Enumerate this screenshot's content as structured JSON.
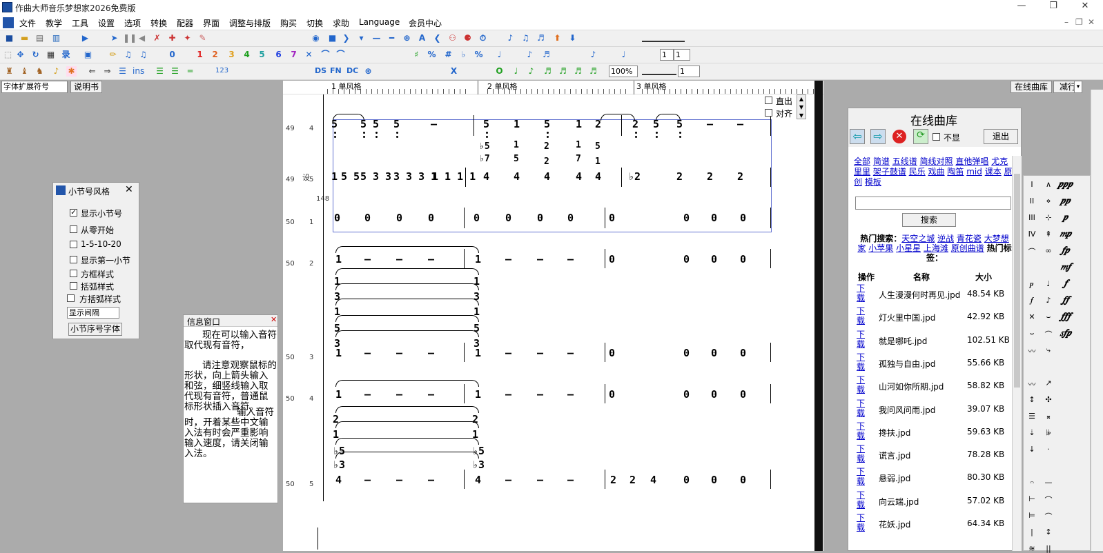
{
  "window": {
    "title": "作曲大师音乐梦想家2026免费版",
    "min": "—",
    "max": "❐",
    "close": "✕"
  },
  "menu": [
    "文件",
    "教学",
    "工具",
    "设置",
    "选项",
    "转换",
    "配器",
    "界面",
    "调整与排版",
    "购买",
    "切换",
    "求助",
    "Language",
    "会员中心"
  ],
  "toolbar": {
    "zoom": "100%",
    "field_a": "1",
    "field_b": "1",
    "field_c": "1"
  },
  "left_toolbar": {
    "symbol_select": "字体扩展符号",
    "manual_button": "说明书"
  },
  "bar_dialog": {
    "title": "小节号风格",
    "options": [
      {
        "label": "显示小节号",
        "checked": true
      },
      {
        "label": "从零开始",
        "checked": false
      },
      {
        "label": "1-5-10-20",
        "checked": false
      },
      {
        "label": "显示第一小节",
        "checked": false
      },
      {
        "label": "方框样式",
        "checked": false
      },
      {
        "label": "括弧样式",
        "checked": false
      },
      {
        "label": "方括弧样式",
        "checked": false
      }
    ],
    "interval_select": "显示间隔",
    "font_button": "小节序号字体"
  },
  "info_window": {
    "title": "信息窗口",
    "text1": "现在可以输入音符取代现有音符，",
    "text2": "请注意观察鼠标的形状，向上箭头输入和弦，细竖线输入取代现有音符，普通鼠标形状插入音符。",
    "text3": "输入音符时，开着某些中文输入法有时会严重影响输入速度，请关闭输入法。"
  },
  "score": {
    "rulers": [
      "1 单风格",
      "2 单风格",
      "3 单风格"
    ],
    "side_checks": [
      "直出",
      "对齐"
    ],
    "bar_label": "148",
    "track_label": "设",
    "row_meta": [
      [
        "49",
        "4"
      ],
      [
        "49",
        "5"
      ],
      [
        "50",
        "1"
      ],
      [
        "50",
        "2"
      ],
      [
        "50",
        "3"
      ],
      [
        "50",
        "4"
      ],
      [
        "50",
        "5"
      ]
    ]
  },
  "right_buttons": {
    "online": "在线曲库",
    "reduce": "减行"
  },
  "library": {
    "title": "在线曲库",
    "no_show": "不显",
    "exit": "退出",
    "links": [
      "全部",
      "简谱",
      "五线谱",
      "简线对照",
      "直他弹唱",
      "尤克里里",
      "架子鼓谱",
      "民乐",
      "戏曲",
      "陶笛",
      "mid",
      "课本",
      "原创",
      "模板"
    ],
    "search_button": "搜索",
    "hot_label": "热门搜索：",
    "hot_items": [
      "天空之城",
      "逆战",
      "青花瓷",
      "大梦想家",
      "小苹果",
      "小星星",
      "上海滩",
      "原创曲谱"
    ],
    "tag_label": "热门标签：",
    "headers": [
      "操作",
      "名称",
      "大小"
    ],
    "download": "下载",
    "files": [
      {
        "name": "人生漫漫何时再见.jpd",
        "size": "48.54 KB"
      },
      {
        "name": "灯火里中国.jpd",
        "size": "42.92 KB"
      },
      {
        "name": "就是哪吒.jpd",
        "size": "102.51 KB"
      },
      {
        "name": "孤独与自由.jpd",
        "size": "55.66 KB"
      },
      {
        "name": "山河如你所期.jpd",
        "size": "58.82 KB"
      },
      {
        "name": "我问风问雨.jpd",
        "size": "39.07 KB"
      },
      {
        "name": "搀扶.jpd",
        "size": "59.63 KB"
      },
      {
        "name": "谎言.jpd",
        "size": "78.28 KB"
      },
      {
        "name": "悬弱.jpd",
        "size": "80.30 KB"
      },
      {
        "name": "向云端.jpd",
        "size": "57.02 KB"
      },
      {
        "name": "花妖.jpd",
        "size": "64.34 KB"
      }
    ]
  },
  "palette": {
    "glyphs": [
      "𝆏𝆏𝆏",
      "𝆏𝆏",
      "𝆏",
      "𝆐𝆏",
      "𝆑𝆏",
      "𝆐𝆑",
      "𝆑",
      "𝆑𝆑",
      "𝆑𝆑𝆑",
      "𝆍𝆑𝆏"
    ]
  }
}
